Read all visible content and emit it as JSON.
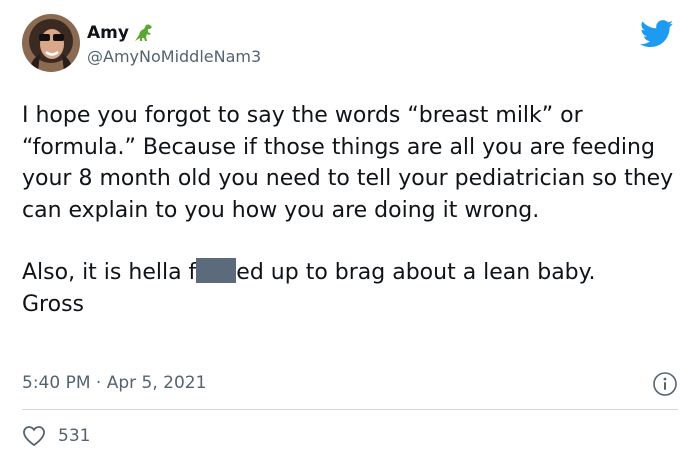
{
  "tweet": {
    "author": {
      "name": "Amy",
      "handle": "@AmyNoMiddleNam3",
      "badge_icon": "dinosaur-emoji-icon"
    },
    "text": {
      "paragraph1": "I hope you forgot to say the words “breast milk” or “formula.” Because if those things are all you are feeding your 8 month old you need to tell your pediatrician so they can explain to you how you are doing it wrong.",
      "paragraph2_before": "Also, it is hella f",
      "paragraph2_after": "ed up to brag about a lean baby.",
      "paragraph3": "Gross"
    },
    "timestamp": "5:40 PM · Apr 5, 2021",
    "likes": "531"
  },
  "colors": {
    "twitter_blue": "#1d9bf0",
    "secondary_text": "#536471",
    "redaction": "#5b6b7b"
  }
}
